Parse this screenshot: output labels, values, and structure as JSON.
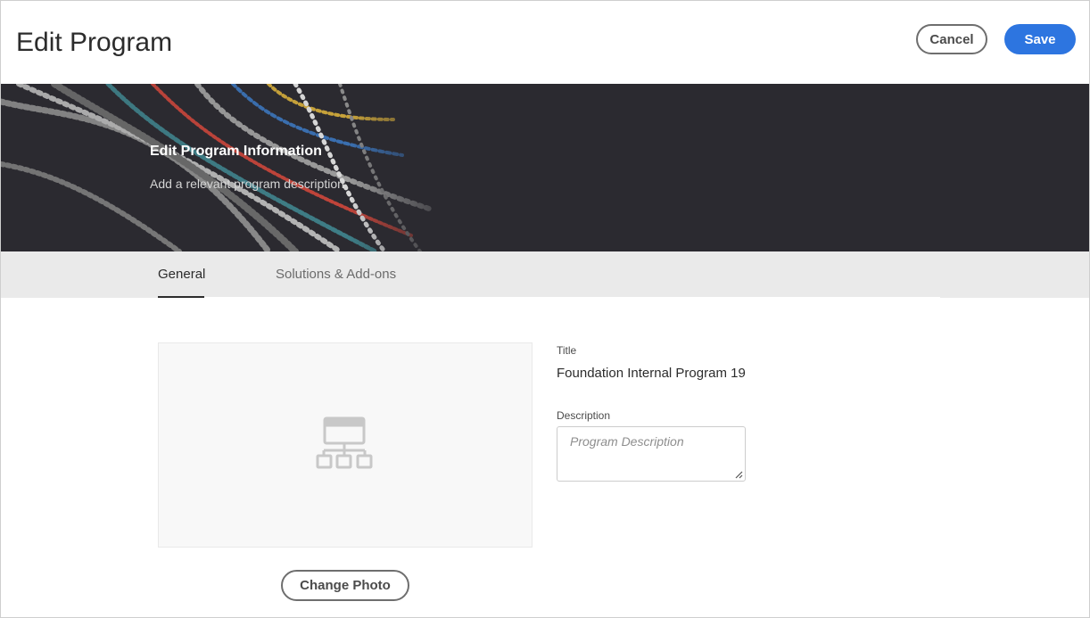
{
  "header": {
    "title": "Edit Program",
    "cancel_label": "Cancel",
    "save_label": "Save"
  },
  "banner": {
    "title": "Edit Program Information",
    "subtitle": "Add a relevant program description."
  },
  "tabs": [
    {
      "label": "General",
      "active": true
    },
    {
      "label": "Solutions & Add-ons",
      "active": false
    }
  ],
  "photo": {
    "icon": "sitemap-icon",
    "change_label": "Change Photo"
  },
  "form": {
    "title_label": "Title",
    "title_value": "Foundation Internal Program 19",
    "description_label": "Description",
    "description_placeholder": "Program Description",
    "description_value": ""
  },
  "colors": {
    "accent": "#2d75e0",
    "banner_bg": "#2b2a30",
    "tabs_bg": "#eaeaea"
  }
}
